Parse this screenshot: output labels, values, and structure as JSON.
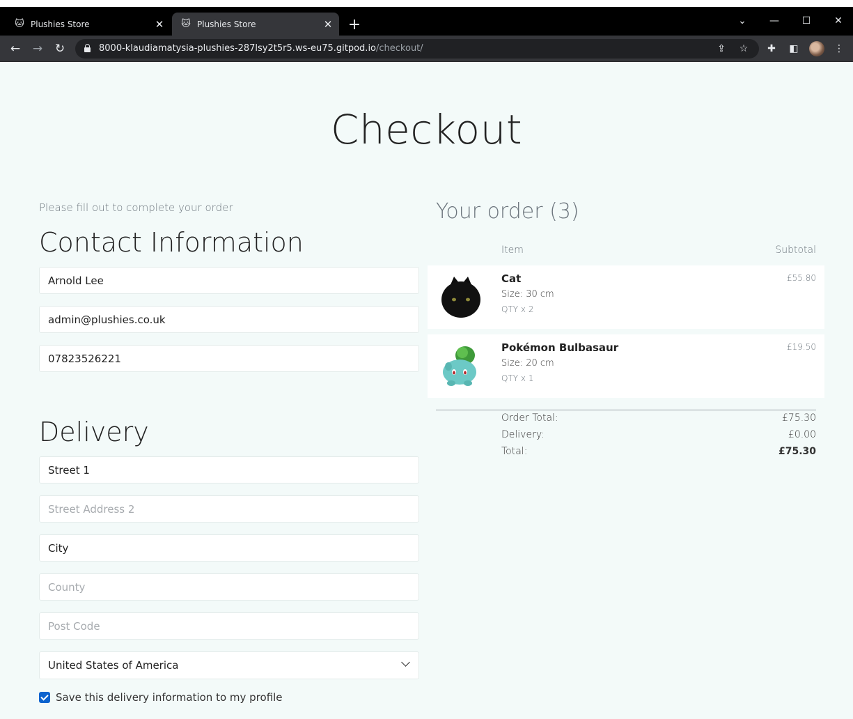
{
  "browser": {
    "tabs": [
      {
        "title": "Plushies Store",
        "active": false
      },
      {
        "title": "Plushies Store",
        "active": true
      }
    ],
    "url_host": "8000-klaudiamatysia-plushies-287lsy2t5r5.ws-eu75.gitpod.io",
    "url_path": "/checkout/"
  },
  "page": {
    "title": "Checkout",
    "subtitle": "Please fill out to complete your order"
  },
  "contact": {
    "heading": "Contact Information",
    "full_name": "Arnold Lee",
    "email": "admin@plushies.co.uk",
    "phone": "07823526221"
  },
  "delivery": {
    "heading": "Delivery",
    "street1": "Street 1",
    "street2_placeholder": "Street Address 2",
    "city": "City",
    "county_placeholder": "County",
    "postcode_placeholder": "Post Code",
    "country": "United States of America",
    "save_label": "Save this delivery information to my profile",
    "save_checked": true
  },
  "order": {
    "heading": "Your order (3)",
    "col_item": "Item",
    "col_subtotal": "Subtotal",
    "items": [
      {
        "name": "Cat",
        "size": "Size: 30 cm",
        "qty": "QTY x 2",
        "price": "£55.80"
      },
      {
        "name": "Pokémon Bulbasaur",
        "size": "Size: 20 cm",
        "qty": "QTY x 1",
        "price": "£19.50"
      }
    ],
    "order_total_label": "Order Total:",
    "order_total": "£75.30",
    "delivery_label": "Delivery:",
    "delivery_cost": "£0.00",
    "grand_total_label": "Total:",
    "grand_total": "£75.30"
  },
  "colors": {
    "page_bg": "#f3faf9",
    "checkbox_accent": "#0b63ce"
  }
}
